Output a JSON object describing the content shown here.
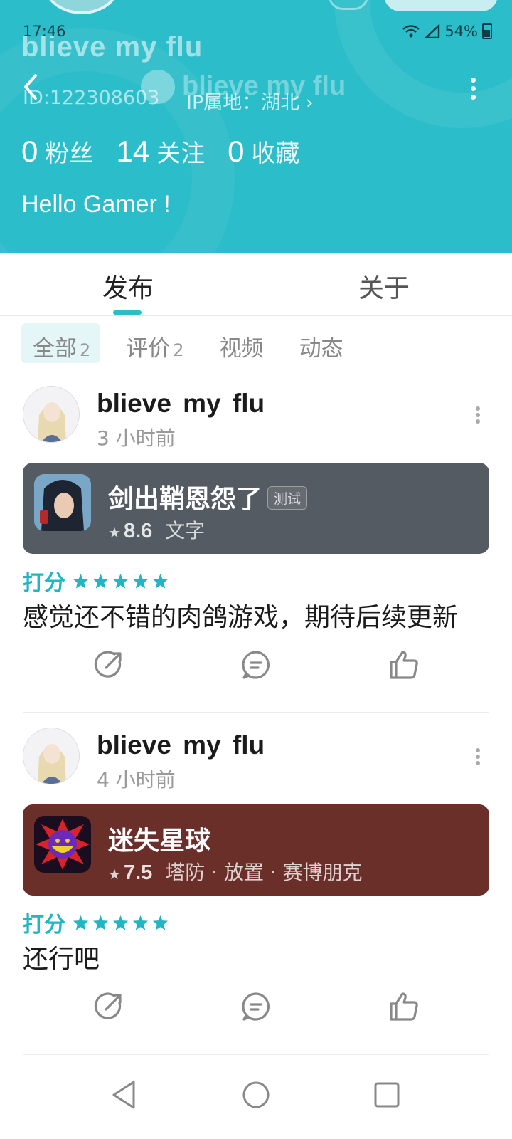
{
  "status_bar": {
    "time": "17:46",
    "battery": "54%"
  },
  "profile": {
    "username": "blieve  my  flu",
    "id_text": "ID:122308603",
    "ip_text": "IP属地：湖北 ›",
    "stats": [
      {
        "num": "0",
        "label": "粉丝"
      },
      {
        "num": "14",
        "label": "关注"
      },
      {
        "num": "0",
        "label": "收藏"
      }
    ],
    "bio": "Hello Gamer !"
  },
  "tabs": [
    {
      "label": "发布",
      "active": true
    },
    {
      "label": "关于",
      "active": false
    }
  ],
  "filters": [
    {
      "label": "全部",
      "count": "2",
      "active": true
    },
    {
      "label": "评价",
      "count": "2",
      "active": false
    },
    {
      "label": "视频",
      "count": "",
      "active": false
    },
    {
      "label": "动态",
      "count": "",
      "active": false
    }
  ],
  "posts": [
    {
      "username": "blieve  my  flu",
      "time": "3 小时前",
      "game": {
        "name": "剑出鞘恩怨了",
        "tag": "测试",
        "score": "8.6",
        "genres": "文字",
        "card_color": "#555b63"
      },
      "rating_label": "打分",
      "stars": 5,
      "review": "感觉还不错的肉鸽游戏，期待后续更新"
    },
    {
      "username": "blieve  my  flu",
      "time": "4 小时前",
      "game": {
        "name": "迷失星球",
        "tag": "",
        "score": "7.5",
        "genres": "塔防 · 放置 · 赛博朋克",
        "card_color": "#6b2f2a"
      },
      "rating_label": "打分",
      "stars": 5,
      "review": "还行吧"
    }
  ],
  "colors": {
    "accent": "#2bbdc9",
    "header_bg": "#2bbdc9"
  }
}
